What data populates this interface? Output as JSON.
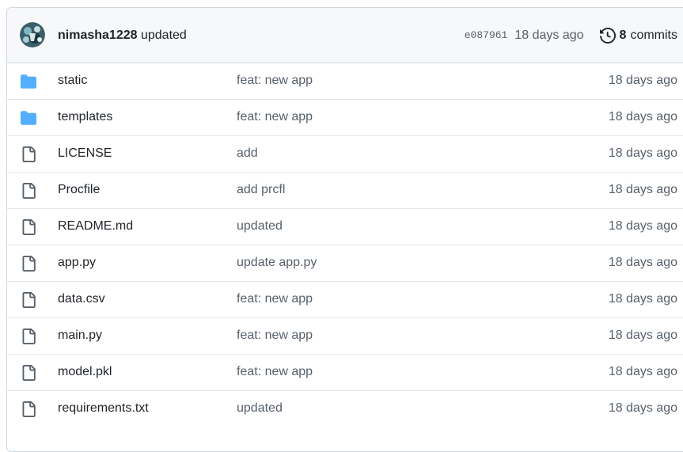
{
  "latest_commit": {
    "author": "nimasha1228",
    "message": "updated",
    "sha": "e087961",
    "age": "18 days ago",
    "commit_count": "8",
    "commits_label": "commits",
    "history_icon": "history-icon"
  },
  "colors": {
    "folder": "#54aeff",
    "file_icon": "#57606a",
    "muted_text": "#57606a",
    "header_bg": "#f6f8fa",
    "border": "#d0d7de"
  },
  "files": [
    {
      "type": "folder",
      "name": "static",
      "message": "feat: new app",
      "age": "18 days ago"
    },
    {
      "type": "folder",
      "name": "templates",
      "message": "feat: new app",
      "age": "18 days ago"
    },
    {
      "type": "file",
      "name": "LICENSE",
      "message": "add",
      "age": "18 days ago"
    },
    {
      "type": "file",
      "name": "Procfile",
      "message": "add prcfl",
      "age": "18 days ago"
    },
    {
      "type": "file",
      "name": "README.md",
      "message": "updated",
      "age": "18 days ago"
    },
    {
      "type": "file",
      "name": "app.py",
      "message": "update app.py",
      "age": "18 days ago"
    },
    {
      "type": "file",
      "name": "data.csv",
      "message": "feat: new app",
      "age": "18 days ago"
    },
    {
      "type": "file",
      "name": "main.py",
      "message": "feat: new app",
      "age": "18 days ago"
    },
    {
      "type": "file",
      "name": "model.pkl",
      "message": "feat: new app",
      "age": "18 days ago"
    },
    {
      "type": "file",
      "name": "requirements.txt",
      "message": "updated",
      "age": "18 days ago"
    }
  ]
}
